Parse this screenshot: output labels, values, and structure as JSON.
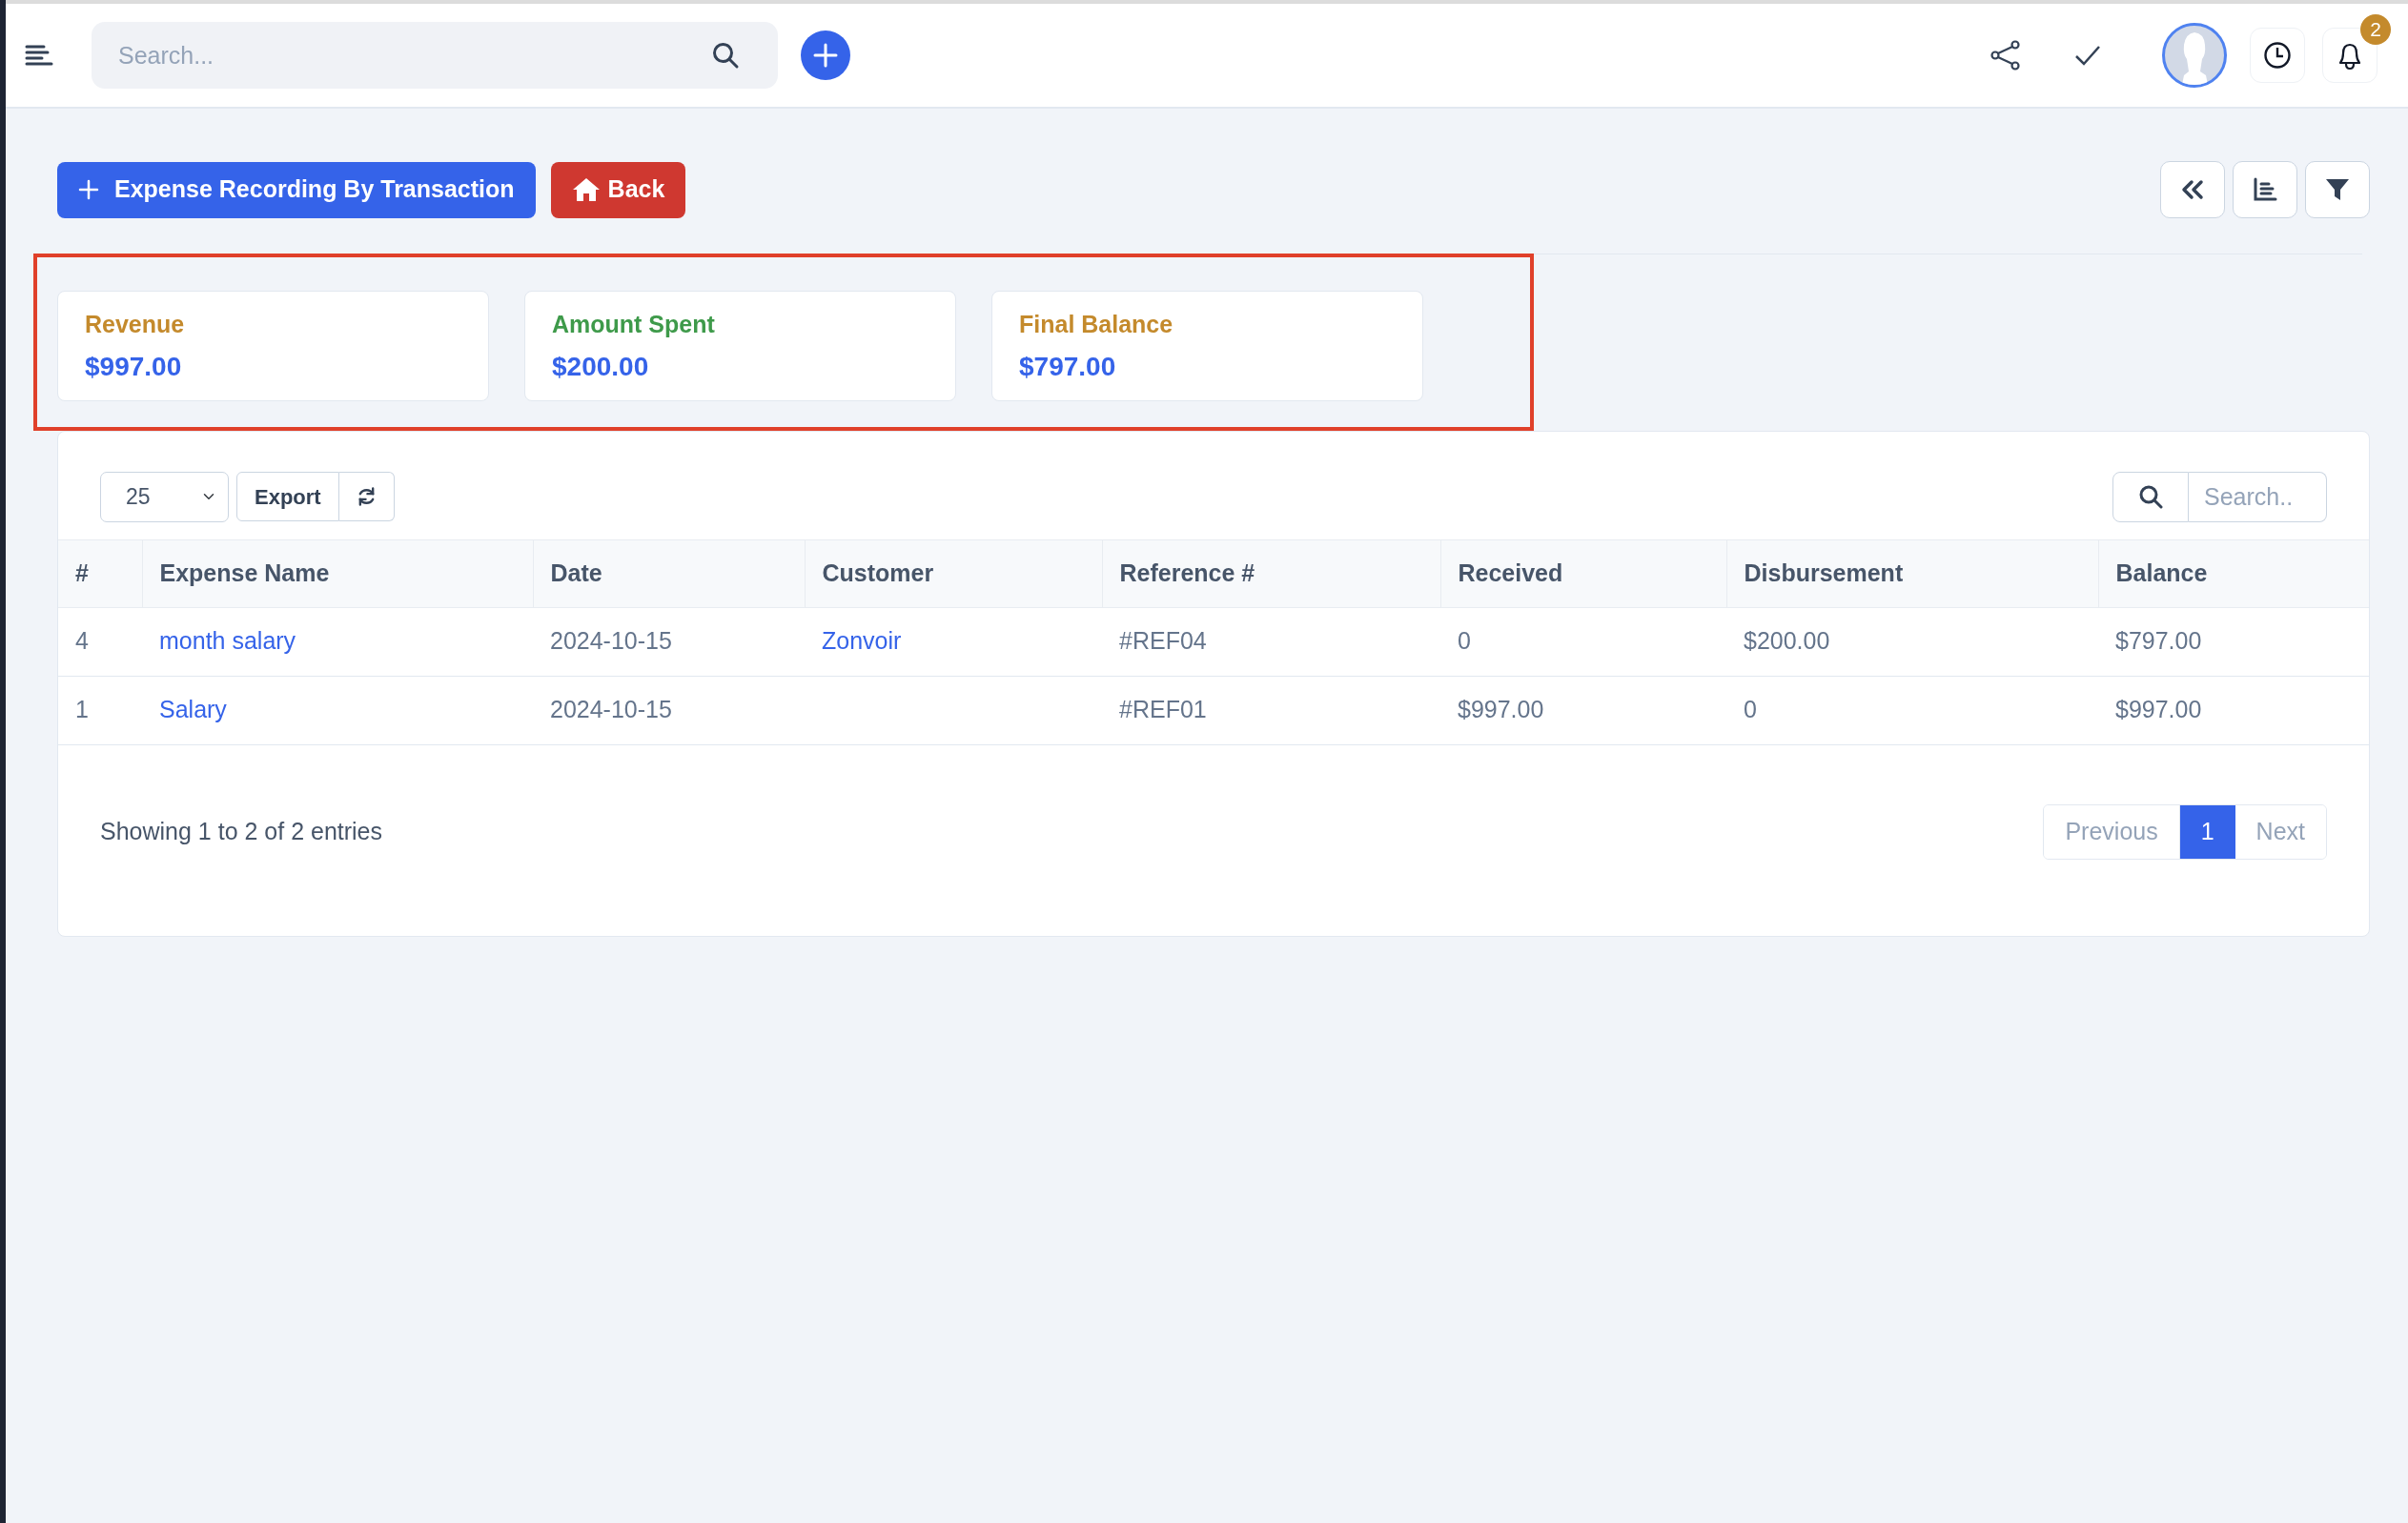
{
  "topbar": {
    "search": {
      "placeholder": "Search..."
    },
    "notification_count": "2"
  },
  "actions": {
    "primary": "Expense Recording By Transaction",
    "back": "Back"
  },
  "summary_cards": [
    {
      "label": "Revenue",
      "value": "$997.00",
      "color": "#c48a2c"
    },
    {
      "label": "Amount Spent",
      "value": "$200.00",
      "color": "#3e9a4a"
    },
    {
      "label": "Final Balance",
      "value": "$797.00",
      "color": "#c48a2c"
    }
  ],
  "table": {
    "page_size": "25",
    "export": "Export",
    "search": {
      "placeholder": "Search.."
    },
    "columns": [
      "#",
      "Expense Name",
      "Date",
      "Customer",
      "Reference #",
      "Received",
      "Disbursement",
      "Balance"
    ],
    "rows": [
      {
        "number": "4",
        "expense_name": "month salary",
        "date": "2024-10-15",
        "customer": "Zonvoir",
        "reference": "#REF04",
        "received": "0",
        "disbursement": "$200.00",
        "balance": "$797.00"
      },
      {
        "number": "1",
        "expense_name": "Salary",
        "date": "2024-10-15",
        "reference": "#REF01",
        "received": "$997.00",
        "disbursement": "0",
        "balance": "$997.00"
      }
    ],
    "info": "Showing 1 to 2 of 2 entries",
    "pagination": {
      "previous": "Previous",
      "pages": [
        {
          "label": "1",
          "selected": true
        }
      ],
      "next": "Next"
    }
  }
}
